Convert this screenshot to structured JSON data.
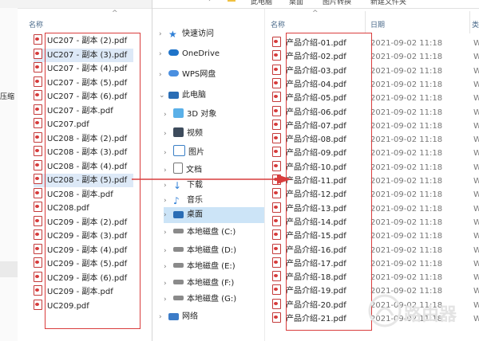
{
  "left_window": {
    "topbar_fragments": [
      "",
      "",
      ""
    ],
    "strip_label": "压缩",
    "column_header": "名称",
    "files": [
      {
        "name": "UC207 - 副本 (2).pdf",
        "selected": false
      },
      {
        "name": "UC207 - 副本 (3).pdf",
        "selected": true
      },
      {
        "name": "UC207 - 副本 (4).pdf",
        "selected": false
      },
      {
        "name": "UC207 - 副本 (5).pdf",
        "selected": false
      },
      {
        "name": "UC207 - 副本 (6).pdf",
        "selected": false
      },
      {
        "name": "UC207 - 副本.pdf",
        "selected": false
      },
      {
        "name": "UC207.pdf",
        "selected": false
      },
      {
        "name": "UC208 - 副本 (2).pdf",
        "selected": false
      },
      {
        "name": "UC208 - 副本 (3).pdf",
        "selected": false
      },
      {
        "name": "UC208 - 副本 (4).pdf",
        "selected": false
      },
      {
        "name": "UC208 - 副本 (5).pdf",
        "selected": true
      },
      {
        "name": "UC208 - 副本.pdf",
        "selected": false
      },
      {
        "name": "UC208.pdf",
        "selected": false
      },
      {
        "name": "UC209 - 副本 (2).pdf",
        "selected": false
      },
      {
        "name": "UC209 - 副本 (3).pdf",
        "selected": false
      },
      {
        "name": "UC209 - 副本 (4).pdf",
        "selected": false
      },
      {
        "name": "UC209 - 副本 (5).pdf",
        "selected": false
      },
      {
        "name": "UC209 - 副本 (6).pdf",
        "selected": false
      },
      {
        "name": "UC209 - 副本.pdf",
        "selected": false
      },
      {
        "name": "UC209.pdf",
        "selected": false
      }
    ]
  },
  "right_window": {
    "breadcrumb": [
      "此电脑",
      "桌面",
      "图片转换",
      "新建文件夹"
    ],
    "columns": {
      "name": "名称",
      "date": "日期",
      "type": "类"
    },
    "nav": {
      "quick_access": "快速访问",
      "onedrive": "OneDrive",
      "wps": "WPS网盘",
      "this_pc": "此电脑",
      "objects3d": "3D 对象",
      "videos": "视频",
      "pictures": "图片",
      "documents": "文档",
      "downloads": "下载",
      "music": "音乐",
      "desktop": "桌面",
      "disk_c": "本地磁盘 (C:)",
      "disk_d": "本地磁盘 (D:)",
      "disk_e": "本地磁盘 (E:)",
      "disk_f": "本地磁盘 (F:)",
      "disk_g": "本地磁盘 (G:)",
      "network": "网络"
    },
    "files": [
      {
        "name": "产品介绍-01.pdf",
        "date": "2021-09-02 11:18",
        "type": "W"
      },
      {
        "name": "产品介绍-02.pdf",
        "date": "2021-09-02 11:18",
        "type": "W"
      },
      {
        "name": "产品介绍-03.pdf",
        "date": "2021-09-02 11:18",
        "type": "W"
      },
      {
        "name": "产品介绍-04.pdf",
        "date": "2021-09-02 11:18",
        "type": "W"
      },
      {
        "name": "产品介绍-05.pdf",
        "date": "2021-09-02 11:18",
        "type": "W"
      },
      {
        "name": "产品介绍-06.pdf",
        "date": "2021-09-02 11:18",
        "type": "W"
      },
      {
        "name": "产品介绍-07.pdf",
        "date": "2021-09-02 11:18",
        "type": "W"
      },
      {
        "name": "产品介绍-08.pdf",
        "date": "2021-09-02 11:18",
        "type": "W"
      },
      {
        "name": "产品介绍-09.pdf",
        "date": "2021-09-02 11:18",
        "type": "W"
      },
      {
        "name": "产品介绍-10.pdf",
        "date": "2021-09-02 11:18",
        "type": "W"
      },
      {
        "name": "产品介绍-11.pdf",
        "date": "2021-09-02 11:18",
        "type": "W"
      },
      {
        "name": "产品介绍-12.pdf",
        "date": "2021-09-02 11:18",
        "type": "W"
      },
      {
        "name": "产品介绍-13.pdf",
        "date": "2021-09-02 11:18",
        "type": "W"
      },
      {
        "name": "产品介绍-14.pdf",
        "date": "2021-09-02 11:18",
        "type": "W"
      },
      {
        "name": "产品介绍-15.pdf",
        "date": "2021-09-02 11:18",
        "type": "W"
      },
      {
        "name": "产品介绍-16.pdf",
        "date": "2021-09-02 11:18",
        "type": "W"
      },
      {
        "name": "产品介绍-17.pdf",
        "date": "2021-09-02 11:18",
        "type": "W"
      },
      {
        "name": "产品介绍-18.pdf",
        "date": "2021-09-02 11:18",
        "type": "W"
      },
      {
        "name": "产品介绍-19.pdf",
        "date": "2021-09-02 11:18",
        "type": "W"
      },
      {
        "name": "产品介绍-20.pdf",
        "date": "2021-09-02 11:18",
        "type": "W"
      },
      {
        "name": "产品介绍-21.pdf",
        "date": "2021-09-02 11:18",
        "type": "W"
      }
    ]
  },
  "watermark": "路由器",
  "colors": {
    "highlight_box": "#d93d3d",
    "arrow": "#d93d3d",
    "selection": "#dde9f7",
    "nav_selected": "#cce4f7"
  }
}
